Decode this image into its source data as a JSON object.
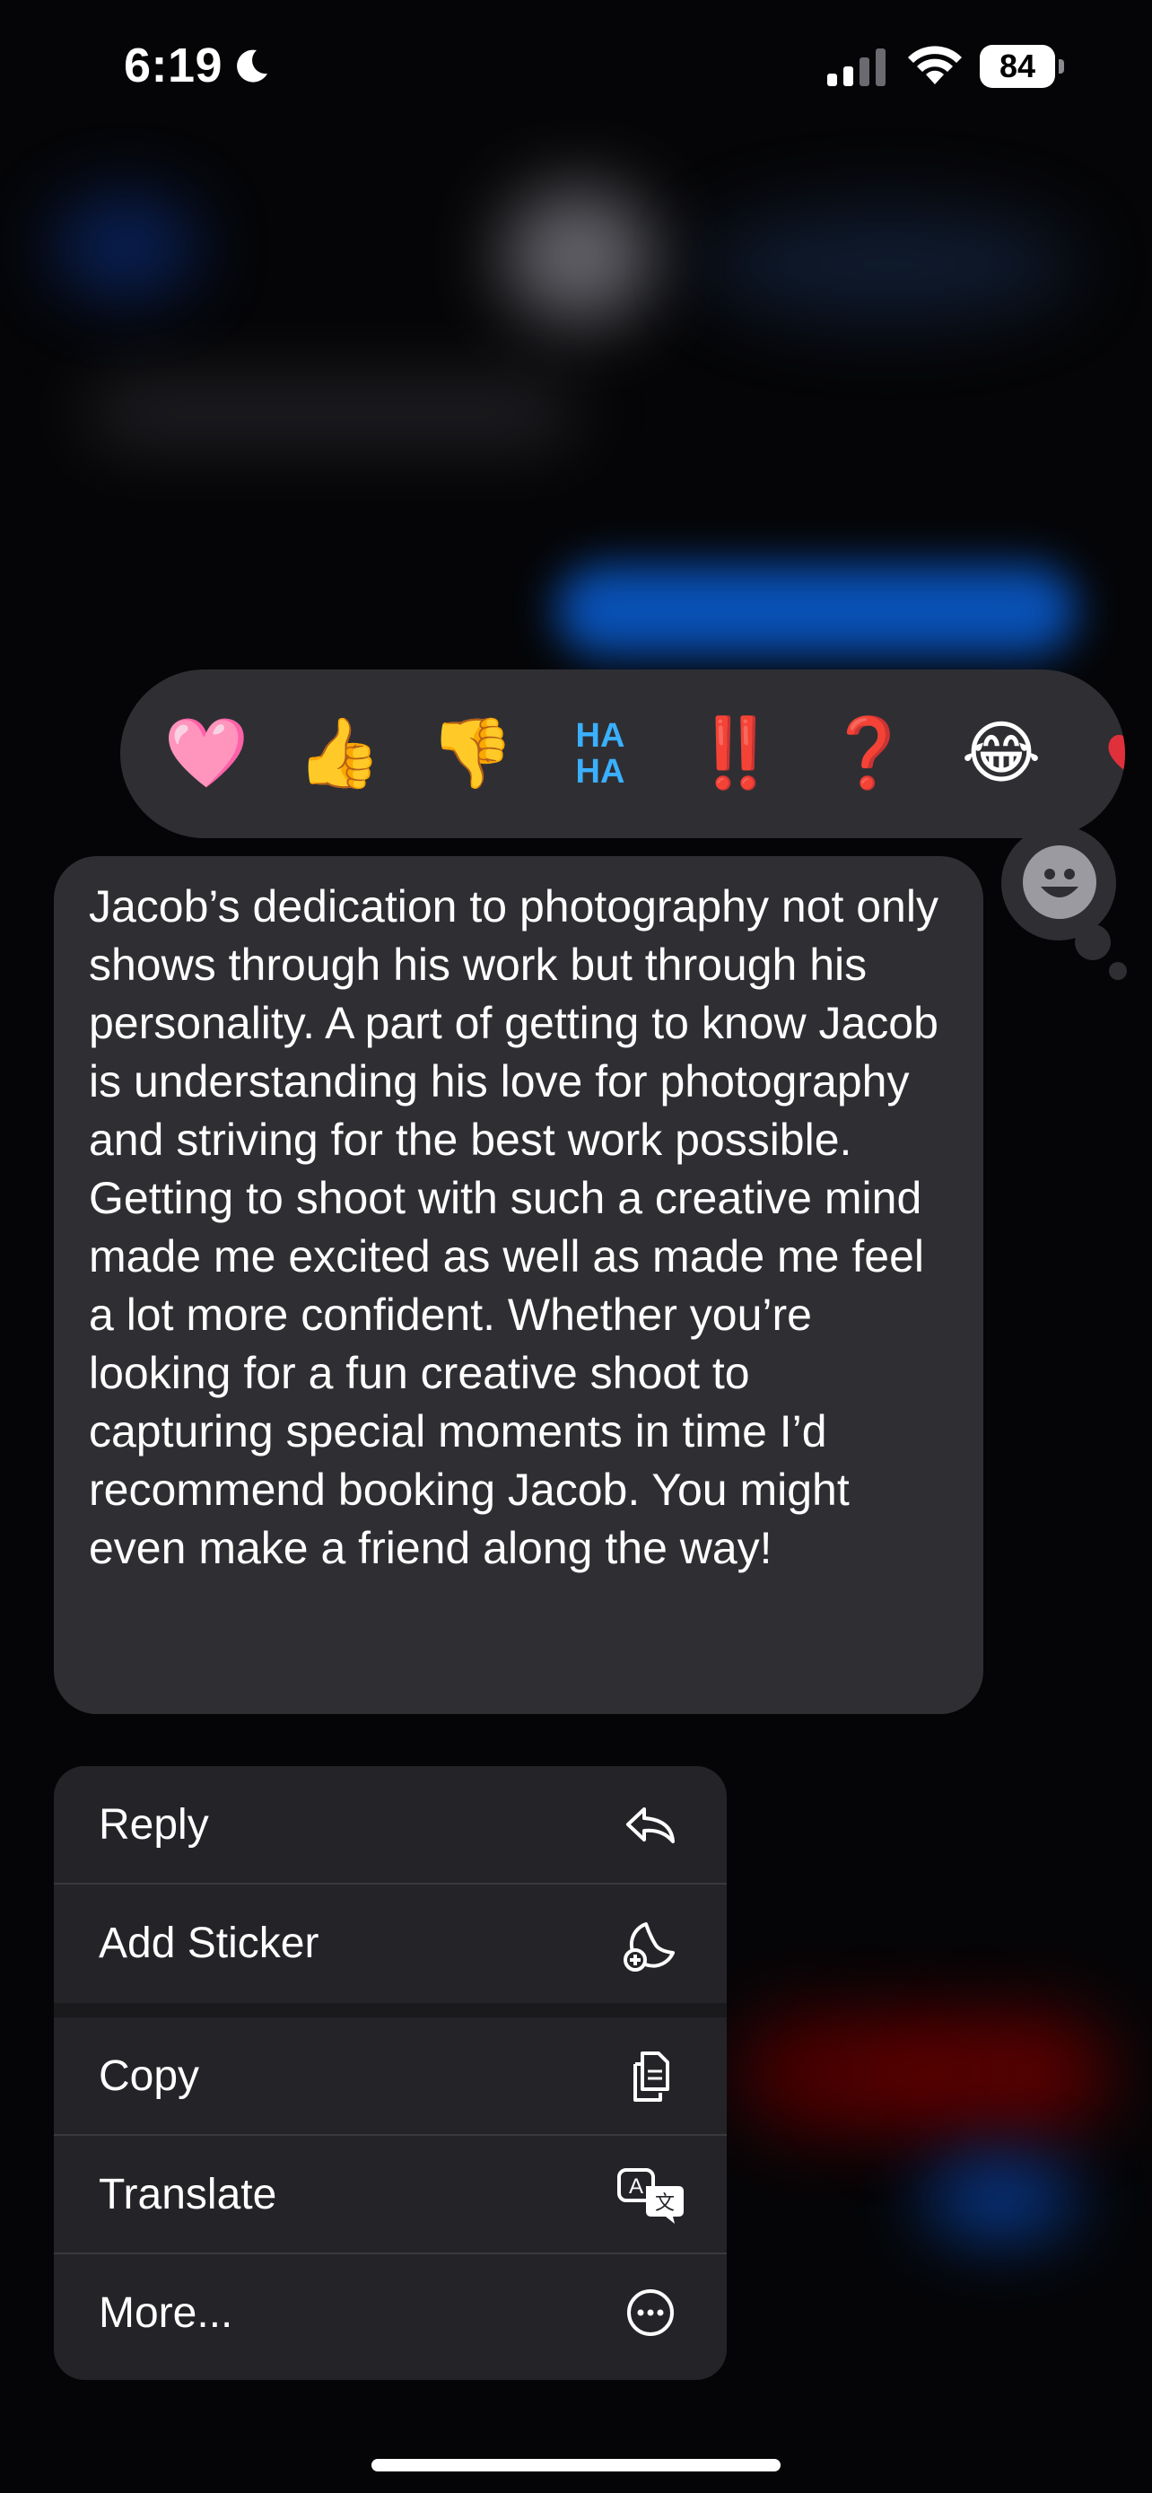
{
  "status_bar": {
    "time": "6:19",
    "battery": "84"
  },
  "reactions": [
    {
      "name": "heart",
      "glyph": "🩷"
    },
    {
      "name": "thumbs-up",
      "glyph": "👍"
    },
    {
      "name": "thumbs-down",
      "glyph": "👎"
    },
    {
      "name": "haha",
      "glyph": "HA HA"
    },
    {
      "name": "exclamation",
      "glyph": "‼️"
    },
    {
      "name": "question",
      "glyph": "❓"
    },
    {
      "name": "laughing",
      "glyph": "😂"
    }
  ],
  "message": {
    "text": "Jacob’s dedication to photography not only shows through his work but through his personality. A part of getting to know Jacob is understanding his love for photography and striving for the best work possible. Getting to shoot with such a creative mind made me excited as well as made me feel a lot more confident. Whether you’re looking for a fun creative shoot to capturing special moments in time I’d recommend booking Jacob. You might even make a friend along the way!"
  },
  "menu": {
    "reply": "Reply",
    "add_sticker": "Add Sticker",
    "copy": "Copy",
    "translate": "Translate",
    "more": "More..."
  },
  "icons": {
    "reply": "reply-arrow-icon",
    "add_sticker": "sticker-add-icon",
    "copy": "copy-documents-icon",
    "translate": "translate-icon",
    "more": "ellipsis-circle-icon",
    "emoji_button": "smiley-icon"
  },
  "colors": {
    "background": "#050507",
    "bubble": "#2f2f33",
    "menu": "#242428",
    "accent_blue": "#0a84ff"
  }
}
